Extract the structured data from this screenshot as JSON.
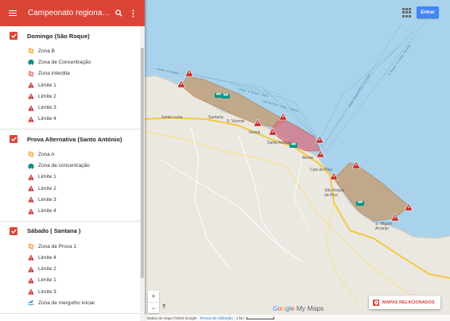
{
  "header": {
    "title": "Campeonato regional i...",
    "menu_icon": "menu-icon",
    "search_icon": "search-icon",
    "more_icon": "more-vert-icon"
  },
  "layers": [
    {
      "title": "Domingo (São Roque)",
      "checked": true,
      "items": [
        {
          "label": "Zona B",
          "icon": "polygon-icon",
          "color": "#f2a33a"
        },
        {
          "label": "Zona de Concentração",
          "icon": "car-icon",
          "color": "#009688"
        },
        {
          "label": "Zona interdita",
          "icon": "polygon-icon",
          "color": "#e06666"
        },
        {
          "label": "Limite 1",
          "icon": "warning-icon",
          "color": "#c62828"
        },
        {
          "label": "Limite 2",
          "icon": "warning-icon",
          "color": "#c62828"
        },
        {
          "label": "Limite 3",
          "icon": "warning-icon",
          "color": "#c62828"
        },
        {
          "label": "Limite 4",
          "icon": "warning-icon",
          "color": "#c62828"
        }
      ]
    },
    {
      "title": "Prova Alternativa (Santo António)",
      "checked": true,
      "items": [
        {
          "label": "Zona A",
          "icon": "polygon-icon",
          "color": "#f2a33a"
        },
        {
          "label": "Zona de concentração",
          "icon": "car-icon",
          "color": "#009688"
        },
        {
          "label": "Limite 1",
          "icon": "warning-icon",
          "color": "#c62828"
        },
        {
          "label": "Limite 2",
          "icon": "warning-icon",
          "color": "#c62828"
        },
        {
          "label": "Limite 3",
          "icon": "warning-icon",
          "color": "#c62828"
        },
        {
          "label": "Limite 4",
          "icon": "warning-icon",
          "color": "#c62828"
        }
      ]
    },
    {
      "title": "Sábado ( Santana )",
      "checked": true,
      "items": [
        {
          "label": "Zona de Prova 1",
          "icon": "polygon-icon",
          "color": "#f2a33a"
        },
        {
          "label": "Limite 4",
          "icon": "warning-icon",
          "color": "#c62828"
        },
        {
          "label": "Limite 2",
          "icon": "warning-icon",
          "color": "#c62828"
        },
        {
          "label": "Limite 1",
          "icon": "warning-icon",
          "color": "#c62828"
        },
        {
          "label": "Limite 3",
          "icon": "warning-icon",
          "color": "#c62828"
        },
        {
          "label": "Zona de  mergulho inicial",
          "icon": "swimmer-icon",
          "color": "#0277bd"
        }
      ]
    }
  ],
  "top_right": {
    "apps_icon": "apps-grid-icon",
    "signin_label": "Entrar"
  },
  "map": {
    "labels": {
      "santa_luzia": "Santa Luzia",
      "santana": "Santana",
      "s_vicente": "S. Vicente",
      "geisal": "Geisal",
      "santo_antonio": "Santo António",
      "almas": "Almas",
      "cais_do_pico": "Cais do Pico",
      "sao_roque_do_pico": "São Roque do Pico",
      "s_miguel_arcanjo": "S. Miguel Arcanjo",
      "ferry_1": "Horta - S. Roque",
      "ferry_2": "Horta - S. Roque - Velas",
      "ferry_3": "Cais do Pico - Velas - Calheta",
      "ferry_4": "Horta - Cais do Pico - S. Jorge",
      "ferry_5": "S. Roque - S. Jorge - Terceira"
    },
    "colors": {
      "sea": "#a9d3ec",
      "land": "#ebe8e1",
      "zone": "#c99a6b",
      "interdicted": "#d9707f",
      "road": "#f4c842"
    }
  },
  "controls": {
    "zoom_in": "+",
    "zoom_out": "−",
    "help": "?"
  },
  "brand": {
    "google": [
      "G",
      "o",
      "o",
      "g",
      "l",
      "e"
    ],
    "my_maps": "My Maps"
  },
  "related": {
    "label": "MAPAS RELACIONADOS",
    "icon": "map-marker-icon"
  },
  "footer": {
    "data": "Dados do mapa ©2016 Google",
    "terms": "Termos de Utilização",
    "scale": "1 km"
  }
}
